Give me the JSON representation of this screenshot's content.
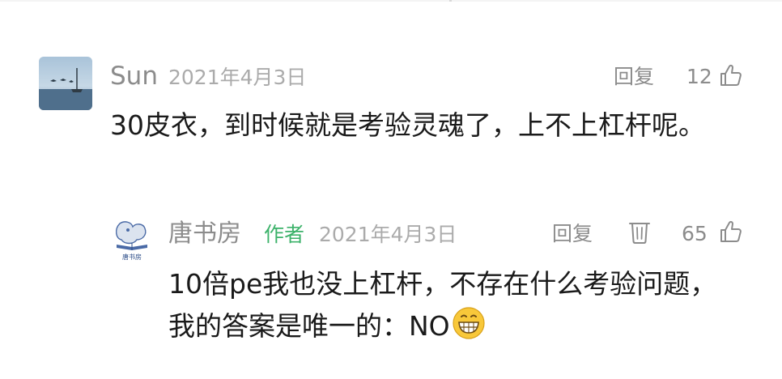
{
  "comment": {
    "username": "Sun",
    "date": "2021年4月3日",
    "reply_label": "回复",
    "likes": "12",
    "text": "30皮衣，到时候就是考验灵魂了，上不上杠杆呢。"
  },
  "reply": {
    "username": "唐书房",
    "author_badge": "作者",
    "avatar_caption": "唐书房",
    "date": "2021年4月3日",
    "reply_label": "回复",
    "likes": "65",
    "text": "10倍pe我也没上杠杆，不存在什么考验问题，我的答案是唯一的：NO"
  },
  "icons": {
    "like": "thumbs-up-icon",
    "delete": "trash-icon",
    "emoji": "grinning-face-icon"
  },
  "colors": {
    "author_badge": "#3cb26a",
    "meta_text": "#8c8c8c",
    "date_text": "#ababab",
    "body_text": "#1a1a1a"
  }
}
